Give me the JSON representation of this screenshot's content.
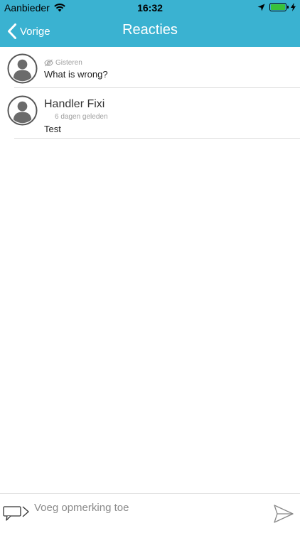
{
  "status_bar": {
    "carrier": "Aanbieder",
    "time": "16:32",
    "battery_color": "#38c23a"
  },
  "nav": {
    "back_label": "Vorige",
    "title": "Reacties",
    "bar_color": "#3ab2d1"
  },
  "comments": [
    {
      "author": "",
      "hidden_icon": "eye-off-icon",
      "timestamp": "Gisteren",
      "text": "What is wrong?"
    },
    {
      "author": "Handler Fixi",
      "timestamp": "6 dagen geleden",
      "text": "Test"
    }
  ],
  "input": {
    "placeholder": "Voeg opmerking toe",
    "value": ""
  }
}
